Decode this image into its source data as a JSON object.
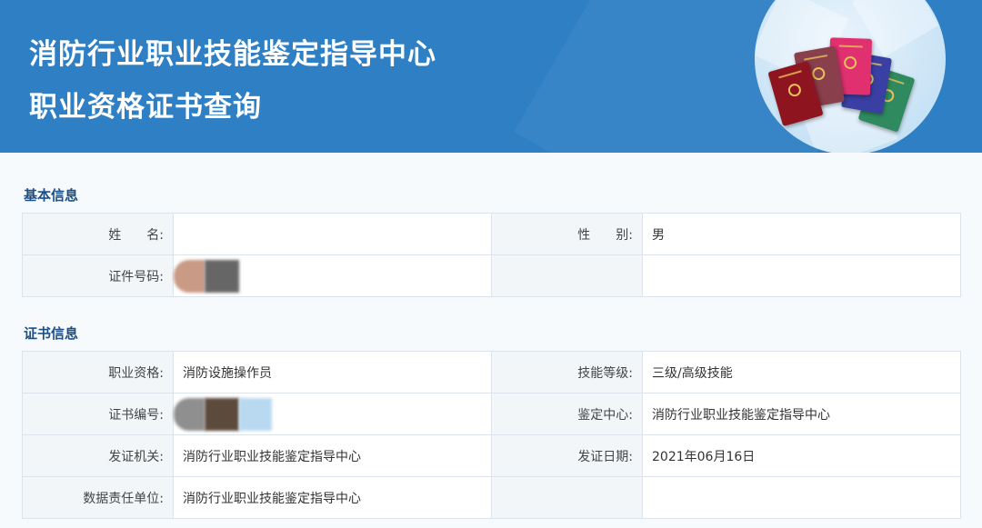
{
  "header": {
    "title_line1": "消防行业职业技能鉴定指导中心",
    "title_line2": "职业资格证书查询"
  },
  "basic_info": {
    "section_title": "基本信息",
    "name_label": "姓　　名:",
    "name_value": "",
    "gender_label": "性　　别:",
    "gender_value": "男",
    "id_label": "证件号码:",
    "id_value": ""
  },
  "certificate_info": {
    "section_title": "证书信息",
    "qualification_label": "职业资格:",
    "qualification_value": "消防设施操作员",
    "skill_level_label": "技能等级:",
    "skill_level_value": "三级/高级技能",
    "cert_no_label": "证书编号:",
    "cert_no_value": "",
    "appraisal_center_label": "鉴定中心:",
    "appraisal_center_value": "消防行业职业技能鉴定指导中心",
    "issuer_label": "发证机关:",
    "issuer_value": "消防行业职业技能鉴定指导中心",
    "issue_date_label": "发证日期:",
    "issue_date_value": "2021年06月16日",
    "data_unit_label": "数据责任单位:",
    "data_unit_value": "消防行业职业技能鉴定指导中心"
  },
  "colors": {
    "banner": "#2f7fc4",
    "section_title": "#1d4f86",
    "label_bg": "#f3f6f9",
    "border": "#dde3ea"
  },
  "icons": {
    "certificate_books": "certificate-books-illustration"
  }
}
